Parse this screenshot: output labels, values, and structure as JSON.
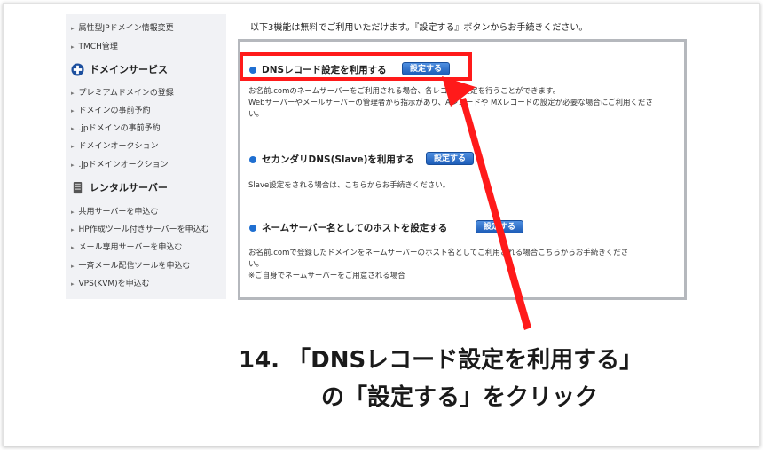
{
  "sidebar": {
    "top_items": [
      "属性型JPドメイン情報変更",
      "TMCH管理"
    ],
    "domain_section": {
      "title": "ドメインサービス",
      "items": [
        "プレミアムドメインの登録",
        "ドメインの事前予約",
        ".jpドメインの事前予約",
        "ドメインオークション",
        ".jpドメインオークション"
      ]
    },
    "server_section": {
      "title": "レンタルサーバー",
      "items": [
        "共用サーバーを申込む",
        "HP作成ツール付きサーバーを申込む",
        "メール専用サーバーを申込む",
        "一斉メール配信ツールを申込む",
        "VPS(KVM)を申込む"
      ]
    }
  },
  "main": {
    "intro": "以下3機能は無料でご利用いただけます。『設定する』ボタンからお手続きください。",
    "sections": [
      {
        "title": "DNSレコード設定を利用する",
        "button": "設定する",
        "lines": [
          "お名前.comのネームサーバーをご利用される場合、各レコード設定を行うことができます。",
          "Webサーバーやメールサーバーの管理者から指示があり、Aレコードや MXレコードの設定が必要な場合にご利用くださ",
          "い。"
        ]
      },
      {
        "title": "セカンダリDNS(Slave)を利用する",
        "button": "設定する",
        "lines": [
          "Slave設定をされる場合は、こちらからお手続きください。"
        ]
      },
      {
        "title": "ネームサーバー名としてのホストを設定する",
        "button": "設定する",
        "lines": [
          "お名前.comで登録したドメインをネームサーバーのホスト名としてご利用される場合こちらからお手続きくださ",
          "い。",
          "※ご自身でネームサーバーをご用意される場合"
        ]
      }
    ]
  },
  "annotation": {
    "line1": "14. 「DNSレコード設定を利用する」",
    "line2": "の「設定する」をクリック"
  },
  "colors": {
    "accent": "#1f6fd1",
    "highlight": "#ff1a1a"
  }
}
